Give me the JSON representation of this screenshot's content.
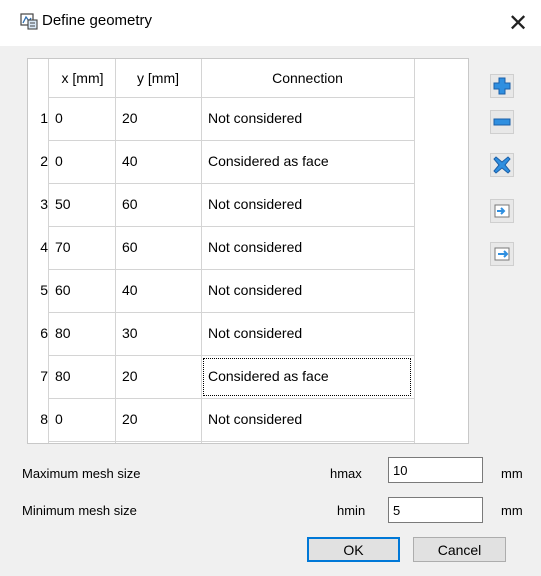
{
  "window": {
    "title": "Define geometry",
    "close_glyph": "✕",
    "app_icon": "app-icon"
  },
  "table": {
    "headers": [
      "x [mm]",
      "y [mm]",
      "Connection"
    ],
    "rows": [
      {
        "num": "1",
        "x": "0",
        "y": "20",
        "connection": "Not considered"
      },
      {
        "num": "2",
        "x": "0",
        "y": "40",
        "connection": "Considered as face"
      },
      {
        "num": "3",
        "x": "50",
        "y": "60",
        "connection": "Not considered"
      },
      {
        "num": "4",
        "x": "70",
        "y": "60",
        "connection": "Not considered"
      },
      {
        "num": "5",
        "x": "60",
        "y": "40",
        "connection": "Not considered"
      },
      {
        "num": "6",
        "x": "80",
        "y": "30",
        "connection": "Not considered"
      },
      {
        "num": "7",
        "x": "80",
        "y": "20",
        "connection": "Considered as face"
      },
      {
        "num": "8",
        "x": "0",
        "y": "20",
        "connection": "Not considered"
      }
    ],
    "focused_row": 7
  },
  "side_buttons": [
    "plus-icon",
    "minus-icon",
    "delete-icon",
    "insert-before-icon",
    "insert-after-icon"
  ],
  "mesh": {
    "max_label": "Maximum mesh size",
    "max_symbol": "hmax",
    "max_value": "10",
    "max_unit": "mm",
    "min_label": "Minimum mesh size",
    "min_symbol": "hmin",
    "min_value": "5",
    "min_unit": "mm"
  },
  "buttons": {
    "ok": "OK",
    "cancel": "Cancel"
  },
  "colors": {
    "icon_blue": "#2f8fe0",
    "focus_border": "#0078d7"
  }
}
